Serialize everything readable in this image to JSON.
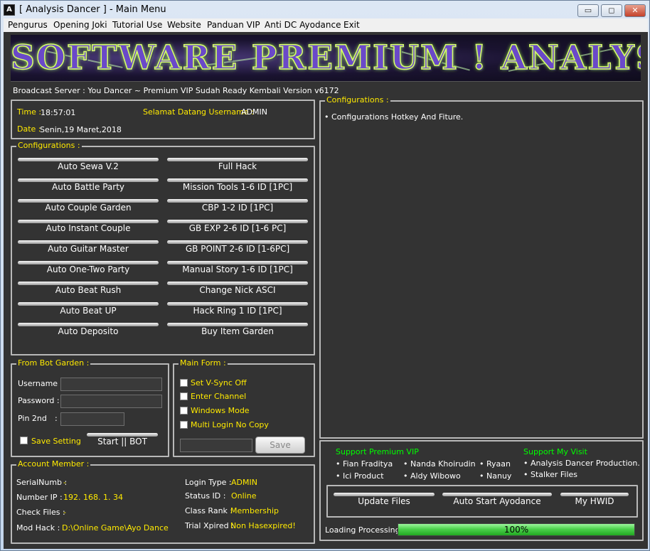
{
  "window": {
    "title": "[ Analysis Dancer ] - Main Menu",
    "app_icon": "A",
    "controls": {
      "minimize": "▭",
      "maximize": "◻",
      "close": "✕"
    }
  },
  "menu": [
    "Pengurus",
    "Opening Joki",
    "Tutorial Use",
    "Website",
    "Panduan VIP",
    "Anti DC Ayodance",
    "Exit"
  ],
  "banner": {
    "text": "SOFTWARE PREMIUM ! ANALYSIS DANCER"
  },
  "broadcast": "Broadcast Server : You Dancer ~ Premium VIP Sudah Ready Kembali Version v6172",
  "info": {
    "time_label": "Time :",
    "time_value": "18:57:01",
    "welcome_label": "Selamat Datang Username :",
    "welcome_value": "ADMIN",
    "date_label": "Date :",
    "date_value": "Senin,19 Maret,2018"
  },
  "config": {
    "title": "Configurations :",
    "left": [
      "Auto Sewa V.2",
      "Auto Battle Party",
      "Auto Couple Garden",
      "Auto Instant Couple",
      "Auto Guitar Master",
      "Auto One-Two Party",
      "Auto Beat Rush",
      "Auto Beat UP",
      "Auto Deposito"
    ],
    "right": [
      "Full Hack",
      "Mission Tools 1-6 ID [1PC]",
      "CBP 1-2 ID [1PC]",
      "GB EXP 2-6 ID [1-6 PC]",
      "GB POINT 2-6 ID [1-6PC]",
      "Manual Story 1-6 ID [1PC]",
      "Change Nick ASCI",
      "Hack Ring 1 ID [1PC]",
      "Buy Item Garden"
    ]
  },
  "bot_garden": {
    "title": "From Bot Garden :",
    "username_label": "Username :",
    "password_label": "Password :",
    "pin_label": "Pin 2nd",
    "pin_colon": ":",
    "save_setting": "Save Setting",
    "start": "Start || BOT"
  },
  "main_form": {
    "title": "Main Form :",
    "options": [
      "Set V-Sync Off",
      "Enter Channel",
      "Windows Mode",
      "Multi Login No Copy"
    ],
    "save": "Save"
  },
  "account": {
    "title": "Account Member :",
    "left": [
      {
        "label": "SerialNumb :",
        "value": "-"
      },
      {
        "label": "Number IP :",
        "value": "192. 168. 1. 34"
      },
      {
        "label": "Check Files :",
        "value": "-"
      },
      {
        "label": "Mod Hack :",
        "value": "D:\\Online Game\\Ayo Dance"
      }
    ],
    "right": [
      {
        "label": "Login Type :",
        "value": "ADMIN"
      },
      {
        "label": "Status ID :",
        "value": "Online"
      },
      {
        "label": "Class Rank :",
        "value": "Membership"
      },
      {
        "label": "Trial Xpired :",
        "value": "Non Hasexpired!"
      }
    ]
  },
  "right_config": {
    "title": "Configurations :",
    "item": "Configurations Hotkey And Fiture."
  },
  "support": {
    "premium_title": "Support Premium VIP",
    "premium_col1": [
      "Fian Fraditya",
      "Ici Product"
    ],
    "premium_col2": [
      "Nanda Khoirudin",
      "Aldy Wibowo"
    ],
    "premium_col3": [
      "Ryaan",
      "Nanuy"
    ],
    "visit_title": "Support My Visit",
    "visit_items": [
      "Analysis Dancer Production.",
      "Stalker Files"
    ]
  },
  "actions": [
    "Update Files",
    "Auto Start Ayodance",
    "My HWID"
  ],
  "loading": {
    "label": "Loading Processing :",
    "value_text": "100%",
    "percent": 100
  }
}
